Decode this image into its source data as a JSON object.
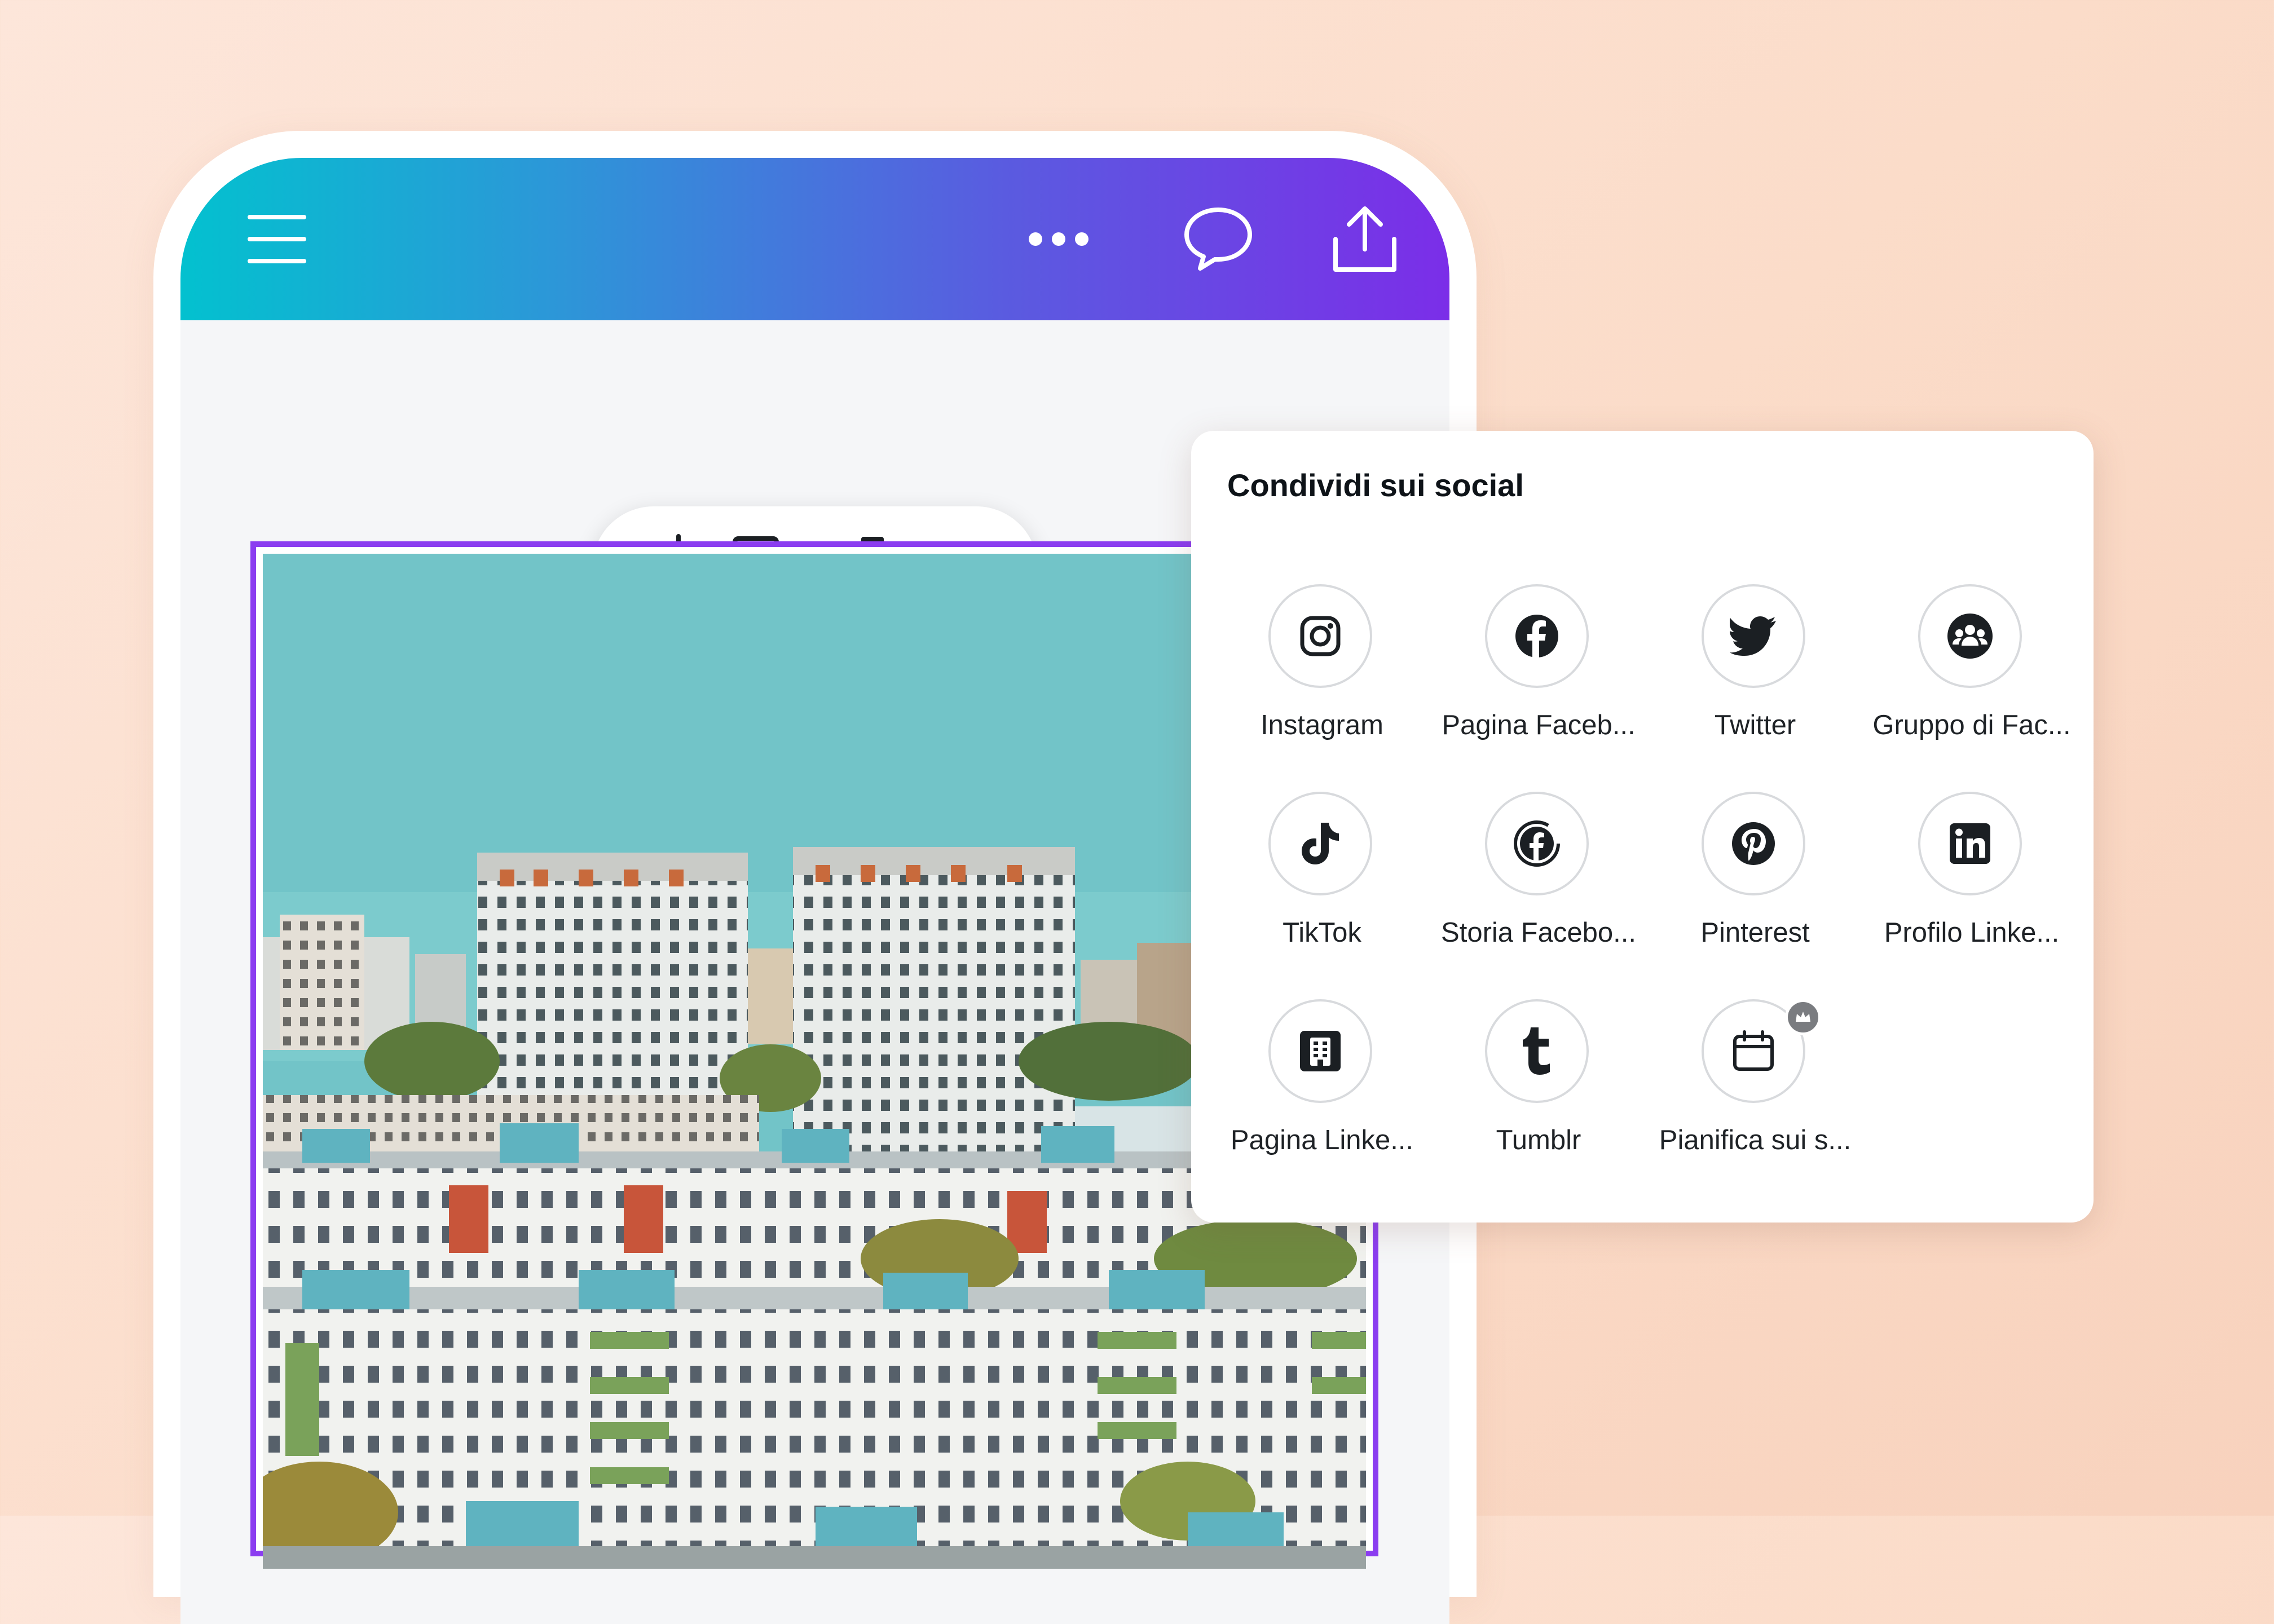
{
  "toolbar": {
    "menu_icon": "hamburger-menu-icon",
    "more_icon": "more-horizontal-icon",
    "comment_icon": "speech-bubble-icon",
    "share_icon": "share-upload-icon",
    "gradient_start": "#03c1cf",
    "gradient_end": "#7b2ee8"
  },
  "page_actions": {
    "add_comment_icon": "add-comment-icon",
    "duplicate_icon": "duplicate-page-icon",
    "delete_icon": "trash-icon",
    "more_icon": "more-horizontal-icon"
  },
  "canvas": {
    "selection_color": "#8b3df0",
    "image": "city-apartment-blocks-photo"
  },
  "share_panel": {
    "title": "Condividi sui social",
    "items": [
      {
        "label": "Instagram",
        "icon": "instagram-icon"
      },
      {
        "label": "Pagina Faceb...",
        "icon": "facebook-icon"
      },
      {
        "label": "Twitter",
        "icon": "twitter-icon"
      },
      {
        "label": "Gruppo di Fac...",
        "icon": "facebook-group-icon"
      },
      {
        "label": "TikTok",
        "icon": "tiktok-icon"
      },
      {
        "label": "Storia Facebo...",
        "icon": "facebook-story-icon"
      },
      {
        "label": "Pinterest",
        "icon": "pinterest-icon"
      },
      {
        "label": "Profilo Linke...",
        "icon": "linkedin-icon"
      },
      {
        "label": "Pagina Linke...",
        "icon": "linkedin-page-icon"
      },
      {
        "label": "Tumblr",
        "icon": "tumblr-icon"
      },
      {
        "label": "Pianifica sui s...",
        "icon": "calendar-icon",
        "premium": true
      }
    ]
  }
}
